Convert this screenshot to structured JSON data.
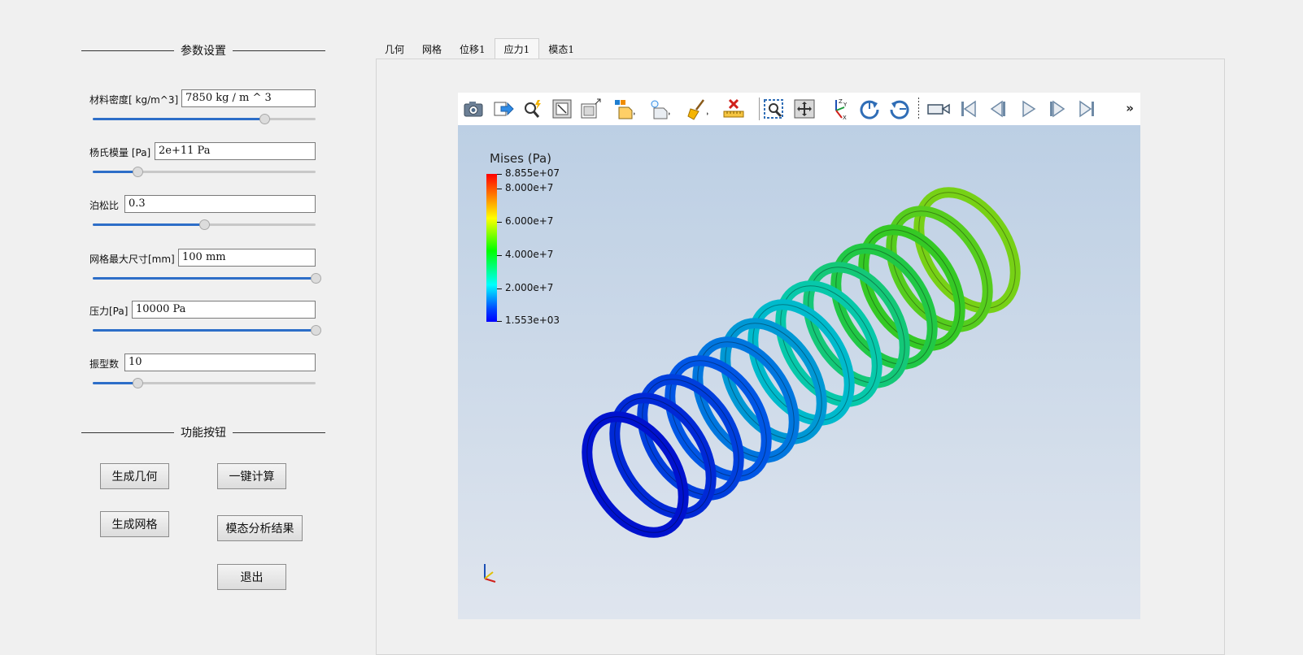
{
  "params_group": {
    "title": "参数设置",
    "fields": [
      {
        "label": "材料密度[ kg/m^3]",
        "value": "7850 kg / m ^ 3",
        "slider": 0.77
      },
      {
        "label": "杨氏模量 [Pa]",
        "value": "2e+11 Pa",
        "slider": 0.2
      },
      {
        "label": "泊松比",
        "value": "0.3",
        "slider": 0.5
      },
      {
        "label": "网格最大尺寸[mm]",
        "value": "100 mm",
        "slider": 1.0
      },
      {
        "label": "压力[Pa]",
        "value": "10000 Pa",
        "slider": 1.0
      },
      {
        "label": "振型数",
        "value": "10",
        "slider": 0.2
      }
    ]
  },
  "function_group": {
    "title": "功能按钮",
    "buttons": {
      "gen_geometry": "生成几何",
      "one_click_compute": "一键计算",
      "gen_mesh": "生成网格",
      "modal_results": "模态分析结果",
      "exit": "退出"
    }
  },
  "tabs": [
    {
      "label": "几何",
      "active": false
    },
    {
      "label": "网格",
      "active": false
    },
    {
      "label": "位移1",
      "active": false
    },
    {
      "label": "应力1",
      "active": true
    },
    {
      "label": "模态1",
      "active": false
    }
  ],
  "viewer": {
    "toolbar_icons": [
      "camera-icon",
      "export-icon",
      "probe-icon",
      "fit-view-icon",
      "maximize-icon",
      "add-object-icon",
      "light-icon",
      "clear-icon",
      "ruler-icon",
      "zoom-box-icon",
      "pan-icon",
      "axes-orient-icon",
      "rotate-cw-icon",
      "rotate-ccw-icon",
      "video-camera-icon",
      "first-frame-icon",
      "prev-frame-icon",
      "play-icon",
      "next-frame-icon",
      "last-frame-icon"
    ],
    "more_label": "»",
    "legend": {
      "title": "Mises (Pa)",
      "max_label": "8.855e+07",
      "min_label": "1.553e+03",
      "ticks": [
        "8.000e+7",
        "6.000e+7",
        "4.000e+7",
        "2.000e+7"
      ],
      "max": 88550000,
      "min": 1553
    },
    "colors": {
      "background_top": "#bccfe4",
      "background_bottom": "#dfe5ee",
      "low": "#0000ff",
      "high": "#ff0000"
    }
  }
}
